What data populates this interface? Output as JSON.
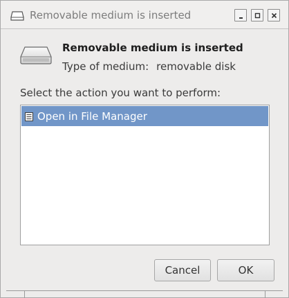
{
  "window": {
    "title": "Removable medium is inserted"
  },
  "dialog": {
    "heading": "Removable medium is inserted",
    "medium_label": "Type of medium:",
    "medium_value": "removable disk",
    "prompt": "Select the action you want to perform:",
    "actions": [
      {
        "label": "Open in File Manager",
        "icon": "file-manager-icon",
        "selected": true
      }
    ]
  },
  "buttons": {
    "cancel_label": "Cancel",
    "ok_label": "OK"
  },
  "colors": {
    "selection": "#7196c8",
    "background": "#edeceb"
  }
}
